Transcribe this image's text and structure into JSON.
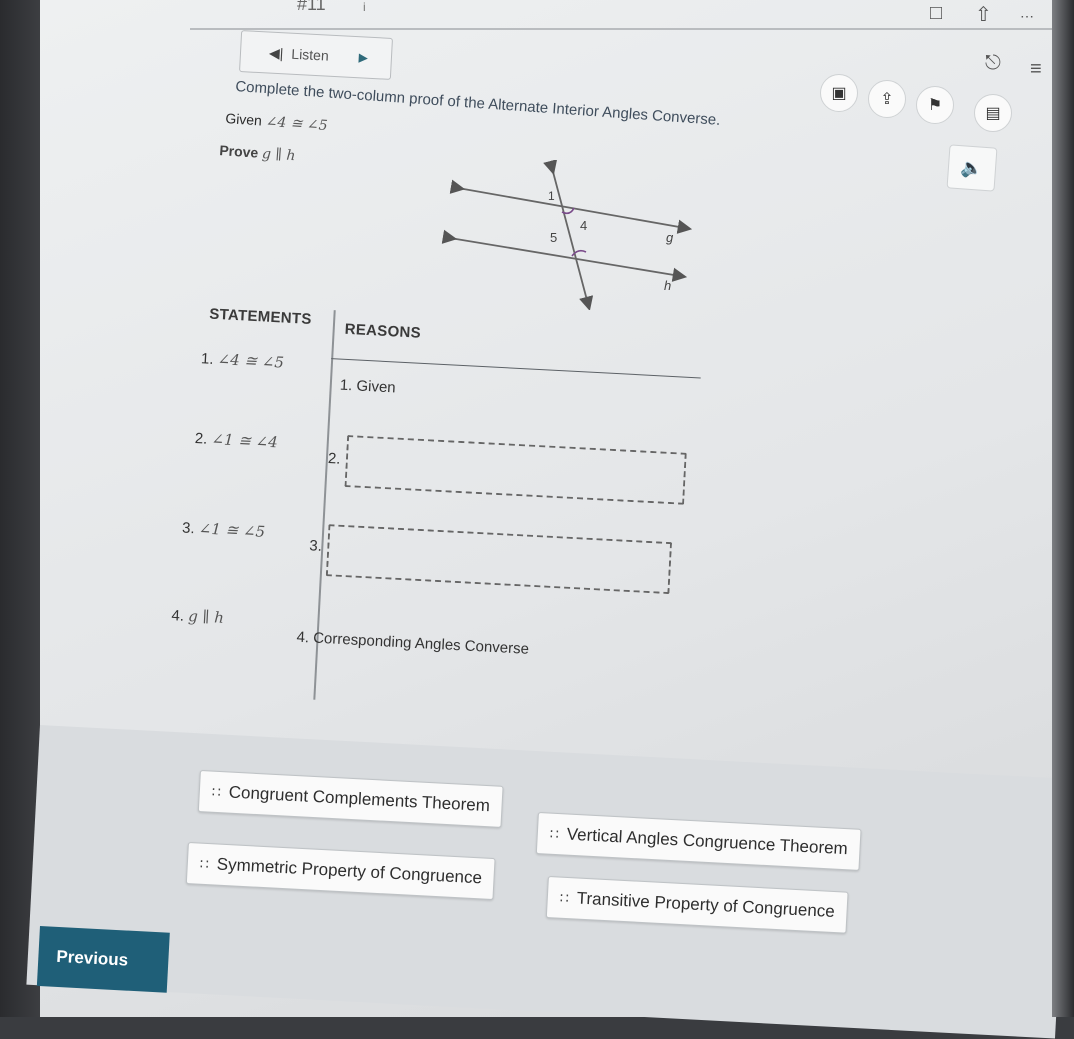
{
  "header": {
    "question_number": "#11",
    "info_icon": "info-icon",
    "listen_label": "Listen"
  },
  "toolbar": {
    "icons": [
      "bookmark-icon",
      "share-icon",
      "more-icon",
      "pin-icon",
      "menu-icon",
      "line-reader-icon",
      "upload-icon",
      "flag-icon",
      "notes-icon"
    ]
  },
  "problem": {
    "instruction": "Complete the two-column proof of the Alternate Interior Angles Converse.",
    "given_label": "Given",
    "given_value": "∠4 ≅ ∠5",
    "prove_label": "Prove",
    "prove_value": "g ∥ h"
  },
  "diagram": {
    "angle_labels": [
      "1",
      "4",
      "5"
    ],
    "line_labels": [
      "g",
      "h"
    ]
  },
  "proof": {
    "headers": {
      "statements": "STATEMENTS",
      "reasons": "REASONS"
    },
    "rows": [
      {
        "num": "1.",
        "statement": "∠4 ≅ ∠5",
        "reason": "1. Given"
      },
      {
        "num": "2.",
        "statement": "∠1 ≅ ∠4",
        "reason": "2."
      },
      {
        "num": "3.",
        "statement": "∠1 ≅ ∠5",
        "reason": "3."
      },
      {
        "num": "4.",
        "statement": "g ∥ h",
        "reason": "4. Corresponding Angles Converse"
      }
    ]
  },
  "answer_choices": [
    "Congruent Complements Theorem",
    "Vertical Angles Congruence Theorem",
    "Symmetric Property of Congruence",
    "Transitive Property of Congruence"
  ],
  "navigation": {
    "previous_label": "Previous"
  }
}
